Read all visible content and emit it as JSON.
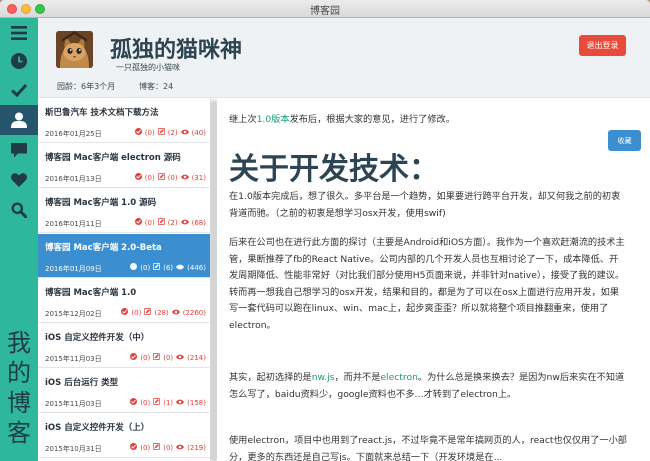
{
  "window": {
    "title": "博客园"
  },
  "sidebar_nav": {
    "icons": [
      "menu-icon",
      "clock-icon",
      "check-icon",
      "user-icon",
      "comment-icon",
      "heart-icon",
      "search-icon"
    ],
    "active": "user-icon",
    "vertical_text": [
      "我",
      "的",
      "博",
      "客"
    ]
  },
  "header": {
    "name": "孤独的猫咪神",
    "tagline": "一只孤独的小猫咪",
    "age": "园龄：6年3个月",
    "posts": "博客：24",
    "logout_label": "退出登录"
  },
  "posts": [
    {
      "title": "斯巴鲁汽车 技术文档下载方法",
      "date": "2016年01月25日",
      "likes": "(0)",
      "comments": "(2)",
      "views": "(40)",
      "selected": false
    },
    {
      "title": "博客园 Mac客户端 electron 源码",
      "date": "2016年01月13日",
      "likes": "(0)",
      "comments": "(0)",
      "views": "(31)",
      "selected": false
    },
    {
      "title": "博客园 Mac客户端 1.0 源码",
      "date": "2016年01月11日",
      "likes": "(0)",
      "comments": "(2)",
      "views": "(68)",
      "selected": false
    },
    {
      "title": "博客园 Mac客户端 2.0-Beta",
      "date": "2016年01月09日",
      "likes": "(0)",
      "comments": "(6)",
      "views": "(446)",
      "selected": true
    },
    {
      "title": "博客园 Mac客户端 1.0",
      "date": "2015年12月02日",
      "likes": "(0)",
      "comments": "(28)",
      "views": "(2260)",
      "selected": false
    },
    {
      "title": "iOS 自定义控件开发（中）",
      "date": "2015年11月03日",
      "likes": "(0)",
      "comments": "(0)",
      "views": "(214)",
      "selected": false
    },
    {
      "title": "iOS 后台运行 类型",
      "date": "2015年11月03日",
      "likes": "(0)",
      "comments": "(1)",
      "views": "(158)",
      "selected": false
    },
    {
      "title": "iOS 自定义控件开发（上）",
      "date": "2015年10月31日",
      "likes": "(0)",
      "comments": "(0)",
      "views": "(219)",
      "selected": false
    }
  ],
  "article": {
    "collect_label": "收藏",
    "intro_before": "继上次",
    "intro_link": "1.0版本",
    "intro_after": "发布后，根据大家的意见，进行了修改。",
    "heading": "关于开发技术：",
    "p1": "在1.0版本完成后，想了很久。多平台是一个趋势，如果要进行跨平台开发，却又何我之前的初衷背道而驰。（之前的初衷是想学习osx开发，使用swif)",
    "p2": "后来在公司也在进行此方面的探讨（主要是Android和iOS方面）。我作为一个喜欢赶潮流的技术主管，果断推荐了fb的React Native。公司内部的几个开发人员也互相讨论了一下，成本降低、开发周期降低、性能非常好（对比我们部分使用H5页面来说，并非针对native），接受了我的建议。转而再一想我自己想学习的osx开发，结果和目的，都是为了可以在osx上面进行应用开发，如果写一套代码可以跑在linux、win、mac上，起步爽歪歪？所以就将整个项目推翻重来，使用了electron。",
    "p3_a": "其实，起初选择的是",
    "p3_link1": "nw.js",
    "p3_b": "，而并不是",
    "p3_link2": "electron",
    "p3_c": "。为什么总是换来换去？是因为nw后来实在不知道怎么写了，baidu资料少，google资料也不多…才转到了electron上。",
    "p4": "使用electron，项目中也用到了react.js，不过毕竟不是常年搞网页的人，react也仅仅用了一小部分，更多的东西还是自己写js。下面就来总结一下（开发环境是在..."
  },
  "colors": {
    "accent": "#2fb79b",
    "nav_active": "#26546a",
    "selected": "#3b8fd0",
    "danger": "#e84a3c"
  }
}
